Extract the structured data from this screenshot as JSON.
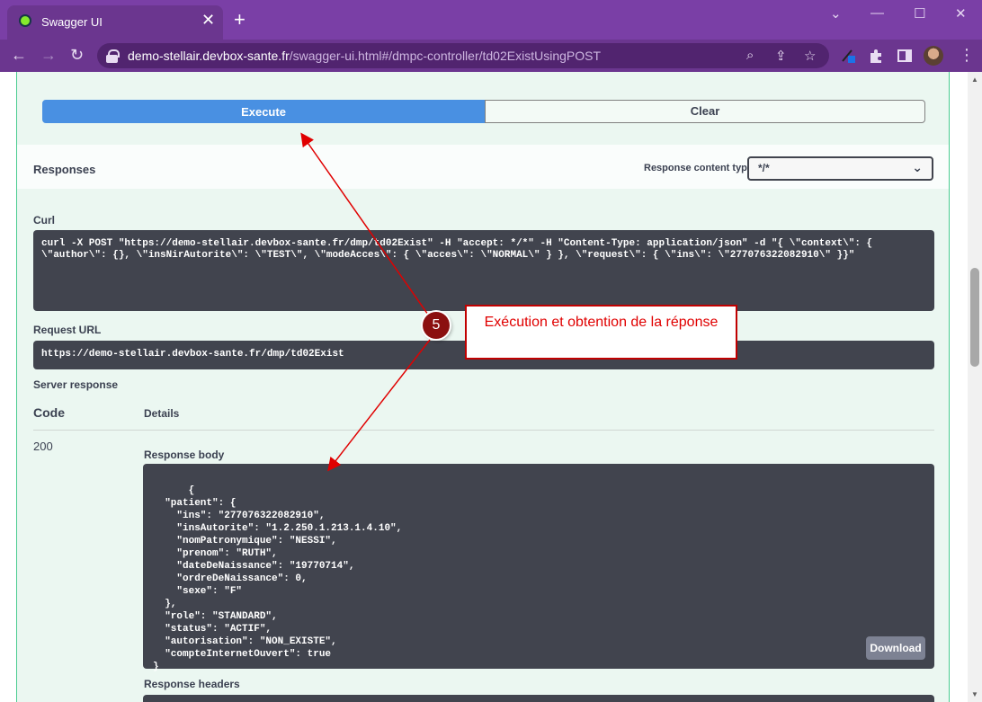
{
  "browser": {
    "tab_title": "Swagger UI",
    "tab_close": "✕",
    "new_tab": "+",
    "window_controls": {
      "minimize": "—",
      "maximize": "☐",
      "close": "✕",
      "tab_search": "⌄"
    },
    "url_host": "demo-stellair.devbox-sante.fr",
    "url_path": "/swagger-ui.html#/dmpc-controller/td02ExistUsingPOST"
  },
  "operation": {
    "execute_label": "Execute",
    "clear_label": "Clear"
  },
  "responses": {
    "title": "Responses",
    "content_type_label": "Response content type",
    "content_type_value": "*/*"
  },
  "curl": {
    "label": "Curl",
    "command": "curl -X POST \"https://demo-stellair.devbox-sante.fr/dmp/td02Exist\" -H \"accept: */*\" -H \"Content-Type: application/json\" -d \"{ \\\"context\\\": {\n\\\"author\\\": {}, \\\"insNirAutorite\\\": \\\"TEST\\\", \\\"modeAcces\\\": { \\\"acces\\\": \\\"NORMAL\\\" } }, \\\"request\\\": { \\\"ins\\\": \\\"277076322082910\\\" }}\""
  },
  "request_url": {
    "label": "Request URL",
    "value": "https://demo-stellair.devbox-sante.fr/dmp/td02Exist"
  },
  "server_response": {
    "label": "Server response",
    "col_code": "Code",
    "col_details": "Details",
    "code": "200",
    "body_label": "Response body",
    "body": "{\n  \"patient\": {\n    \"ins\": \"277076322082910\",\n    \"insAutorite\": \"1.2.250.1.213.1.4.10\",\n    \"nomPatronymique\": \"NESSI\",\n    \"prenom\": \"RUTH\",\n    \"dateDeNaissance\": \"19770714\",\n    \"ordreDeNaissance\": 0,\n    \"sexe\": \"F\"\n  },\n  \"role\": \"STANDARD\",\n  \"status\": \"ACTIF\",\n  \"autorisation\": \"NON_EXISTE\",\n  \"compteInternetOuvert\": true\n}",
    "download_label": "Download",
    "headers_label": "Response headers"
  },
  "annotation": {
    "step_number": "5",
    "callout_text": "Exécution et obtention de la réponse",
    "color": "#e00000"
  },
  "colors": {
    "execute": "#4990e2",
    "post_green": "#49cc90",
    "code_bg": "#41444e",
    "browser_purple": "#7a3fa6"
  }
}
